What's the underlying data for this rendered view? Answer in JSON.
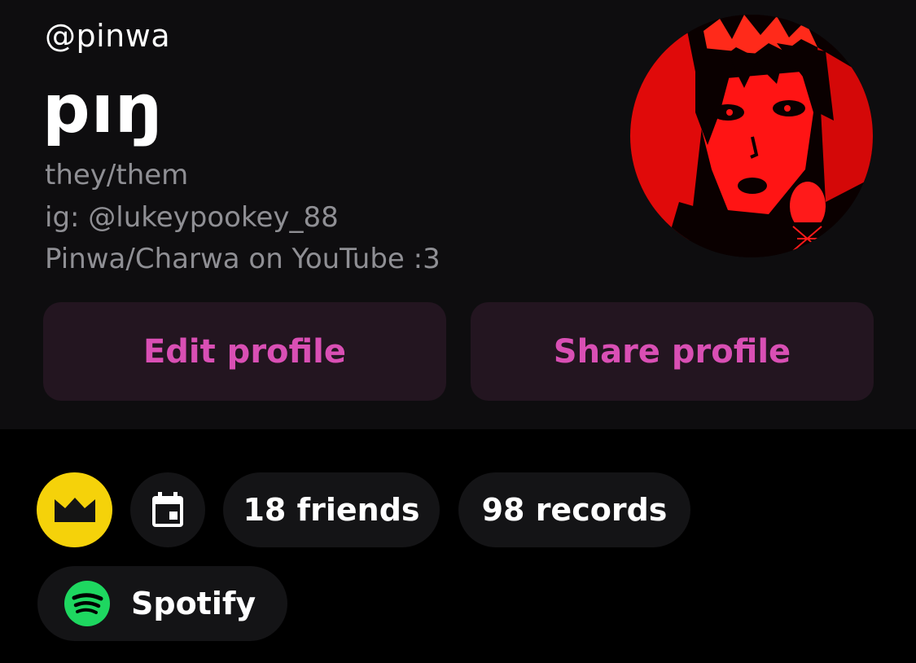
{
  "profile": {
    "username": "@pinwa",
    "display_name": "pıŋ",
    "bio": [
      "they/them",
      "ig: @lukeypookey_88",
      "Pinwa/Charwa on YouTube :3"
    ],
    "avatar_icon": "avatar-image"
  },
  "actions": {
    "edit_label": "Edit profile",
    "share_label": "Share profile"
  },
  "chips": {
    "crown_icon": "crown-icon",
    "calendar_icon": "calendar-icon",
    "friends_label": "18 friends",
    "records_label": "98 records",
    "spotify_label": "Spotify",
    "spotify_icon": "spotify-icon"
  },
  "colors": {
    "background": "#000000",
    "card": "#0e0d0f",
    "accent": "#d94fb4",
    "button_bg": "#231520",
    "muted_text": "#8f8f94",
    "crown_bg": "#f5d20a",
    "spotify_green": "#1ed760"
  }
}
